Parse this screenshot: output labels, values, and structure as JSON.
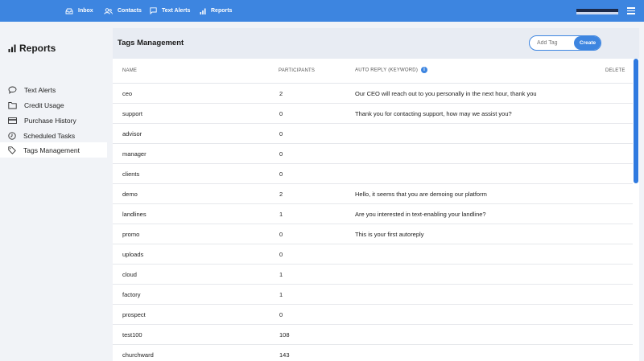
{
  "nav": {
    "items": [
      {
        "label": "Inbox",
        "icon": "inbox-icon"
      },
      {
        "label": "Contacts",
        "icon": "contacts-icon"
      },
      {
        "label": "Text Alerts",
        "icon": "chat-bubble-icon"
      },
      {
        "label": "Reports",
        "icon": "bar-chart-icon"
      }
    ]
  },
  "sidebar": {
    "title": "Reports",
    "items": [
      {
        "label": "Text Alerts",
        "icon": "chat-bubble-icon"
      },
      {
        "label": "Credit Usage",
        "icon": "folder-icon"
      },
      {
        "label": "Purchase History",
        "icon": "credit-card-icon"
      },
      {
        "label": "Scheduled Tasks",
        "icon": "clock-icon"
      },
      {
        "label": "Tags Management",
        "icon": "tag-icon",
        "active": true
      }
    ]
  },
  "panel": {
    "title": "Tags Management",
    "add_tag_placeholder": "Add Tag",
    "create_label": "Create"
  },
  "table": {
    "headers": {
      "name": "NAME",
      "participants": "PARTICIPANTS",
      "auto_reply": "AUTO REPLY (KEYWORD)",
      "delete": "DELETE"
    },
    "rows": [
      {
        "name": "ceo",
        "participants": "2",
        "auto_reply": "Our CEO will reach out to you personally in the next hour, thank you"
      },
      {
        "name": "support",
        "participants": "0",
        "auto_reply": "Thank you for contacting support, how may we assist you?"
      },
      {
        "name": "advisor",
        "participants": "0",
        "auto_reply": ""
      },
      {
        "name": "manager",
        "participants": "0",
        "auto_reply": ""
      },
      {
        "name": "clients",
        "participants": "0",
        "auto_reply": ""
      },
      {
        "name": "demo",
        "participants": "2",
        "auto_reply": "Hello, it seems that you are demoing our platform"
      },
      {
        "name": "landlines",
        "participants": "1",
        "auto_reply": "Are you interested in text-enabling your landline?"
      },
      {
        "name": "promo",
        "participants": "0",
        "auto_reply": "This is your first autoreply"
      },
      {
        "name": "uploads",
        "participants": "0",
        "auto_reply": ""
      },
      {
        "name": "cloud",
        "participants": "1",
        "auto_reply": ""
      },
      {
        "name": "factory",
        "participants": "1",
        "auto_reply": ""
      },
      {
        "name": "prospect",
        "participants": "0",
        "auto_reply": ""
      },
      {
        "name": "test100",
        "participants": "108",
        "auto_reply": ""
      },
      {
        "name": "churchward",
        "participants": "143",
        "auto_reply": ""
      }
    ]
  },
  "colors": {
    "accent": "#3d85e0",
    "sidebar_bg": "#f1f3f7",
    "panel_header_bg": "#e8ecf3"
  }
}
